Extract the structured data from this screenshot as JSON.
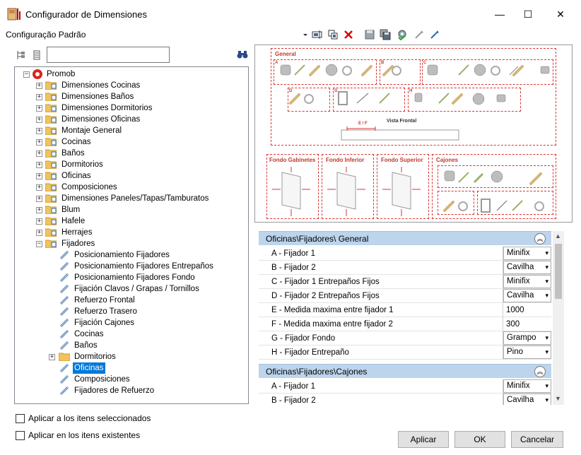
{
  "window": {
    "title": "Configurador de Dimensiones",
    "minimize": "—",
    "maximize": "☐",
    "close": "✕"
  },
  "header": {
    "profile": "Configuração Padrão"
  },
  "tree": {
    "root": "Promob",
    "items": [
      "Dimensiones Cocinas",
      "Dimensiones Baños",
      "Dimensiones Dormitorios",
      "Dimensiones Oficinas",
      "Montaje General",
      "Cocinas",
      "Baños",
      "Dormitorios",
      "Oficinas",
      "Composiciones",
      "Dimensiones Paneles/Tapas/Tamburatos",
      "Blum",
      "Hafele",
      "Herrajes",
      "Fijadores"
    ],
    "children": [
      "Posicionamiento Fijadores",
      "Posicionamiento Fijadores Entrepaños",
      "Posicionamiento Fijadores Fondo",
      "Fijación Clavos / Grapas / Tornillos",
      "Refuerzo Frontal",
      "Refuerzo Trasero",
      "Fijación Cajones",
      "Cocinas",
      "Baños",
      "Dormitorios",
      "Oficinas",
      "Composiciones",
      "Fijadores de Refuerzo"
    ]
  },
  "preview": {
    "general": "General",
    "vista": "Vista Frontal",
    "ef": "E / F",
    "fondo_gabinetes": "Fondo Gabinetes",
    "fondo_inferior": "Fondo Inferior",
    "fondo_superior": "Fondo Superior",
    "cajones": "Cajones",
    "letters": [
      "A",
      "B",
      "C",
      "D",
      "G",
      "H"
    ]
  },
  "grid": {
    "cat1": "Oficinas\\Fijadores\\ General",
    "rows": [
      {
        "name": "A - Fijador 1",
        "value": "Minifix"
      },
      {
        "name": "B - Fijador 2",
        "value": "Cavilha"
      },
      {
        "name": "C - Fijador 1 Entrepaños Fijos",
        "value": "Minifix"
      },
      {
        "name": "D - Fijador 2 Entrepaños Fijos",
        "value": "Cavilha"
      },
      {
        "name": "E - Medida maxima entre fijador 1",
        "value": "1000"
      },
      {
        "name": "F - Medida maxima entre fijador 2",
        "value": "300"
      },
      {
        "name": "G - Fijador Fondo",
        "value": "Grampo"
      },
      {
        "name": "H - Fijador Entrepaño",
        "value": "Pino"
      }
    ],
    "cat2": "Oficinas\\Fijadores\\Cajones",
    "rows2": [
      {
        "name": "A - Fijador 1",
        "value": "Minifix"
      },
      {
        "name": "B - Fijador 2",
        "value": "Cavilha"
      }
    ]
  },
  "footer": {
    "apply_selected": "Aplicar a los itens seleccionados",
    "apply_existing": "Aplicar en los itens existentes",
    "apply": "Aplicar",
    "ok": "OK",
    "cancel": "Cancelar"
  },
  "colors": {
    "accent": "#0078d7",
    "category": "#bcd4ec",
    "preview_red": "#d33333"
  }
}
